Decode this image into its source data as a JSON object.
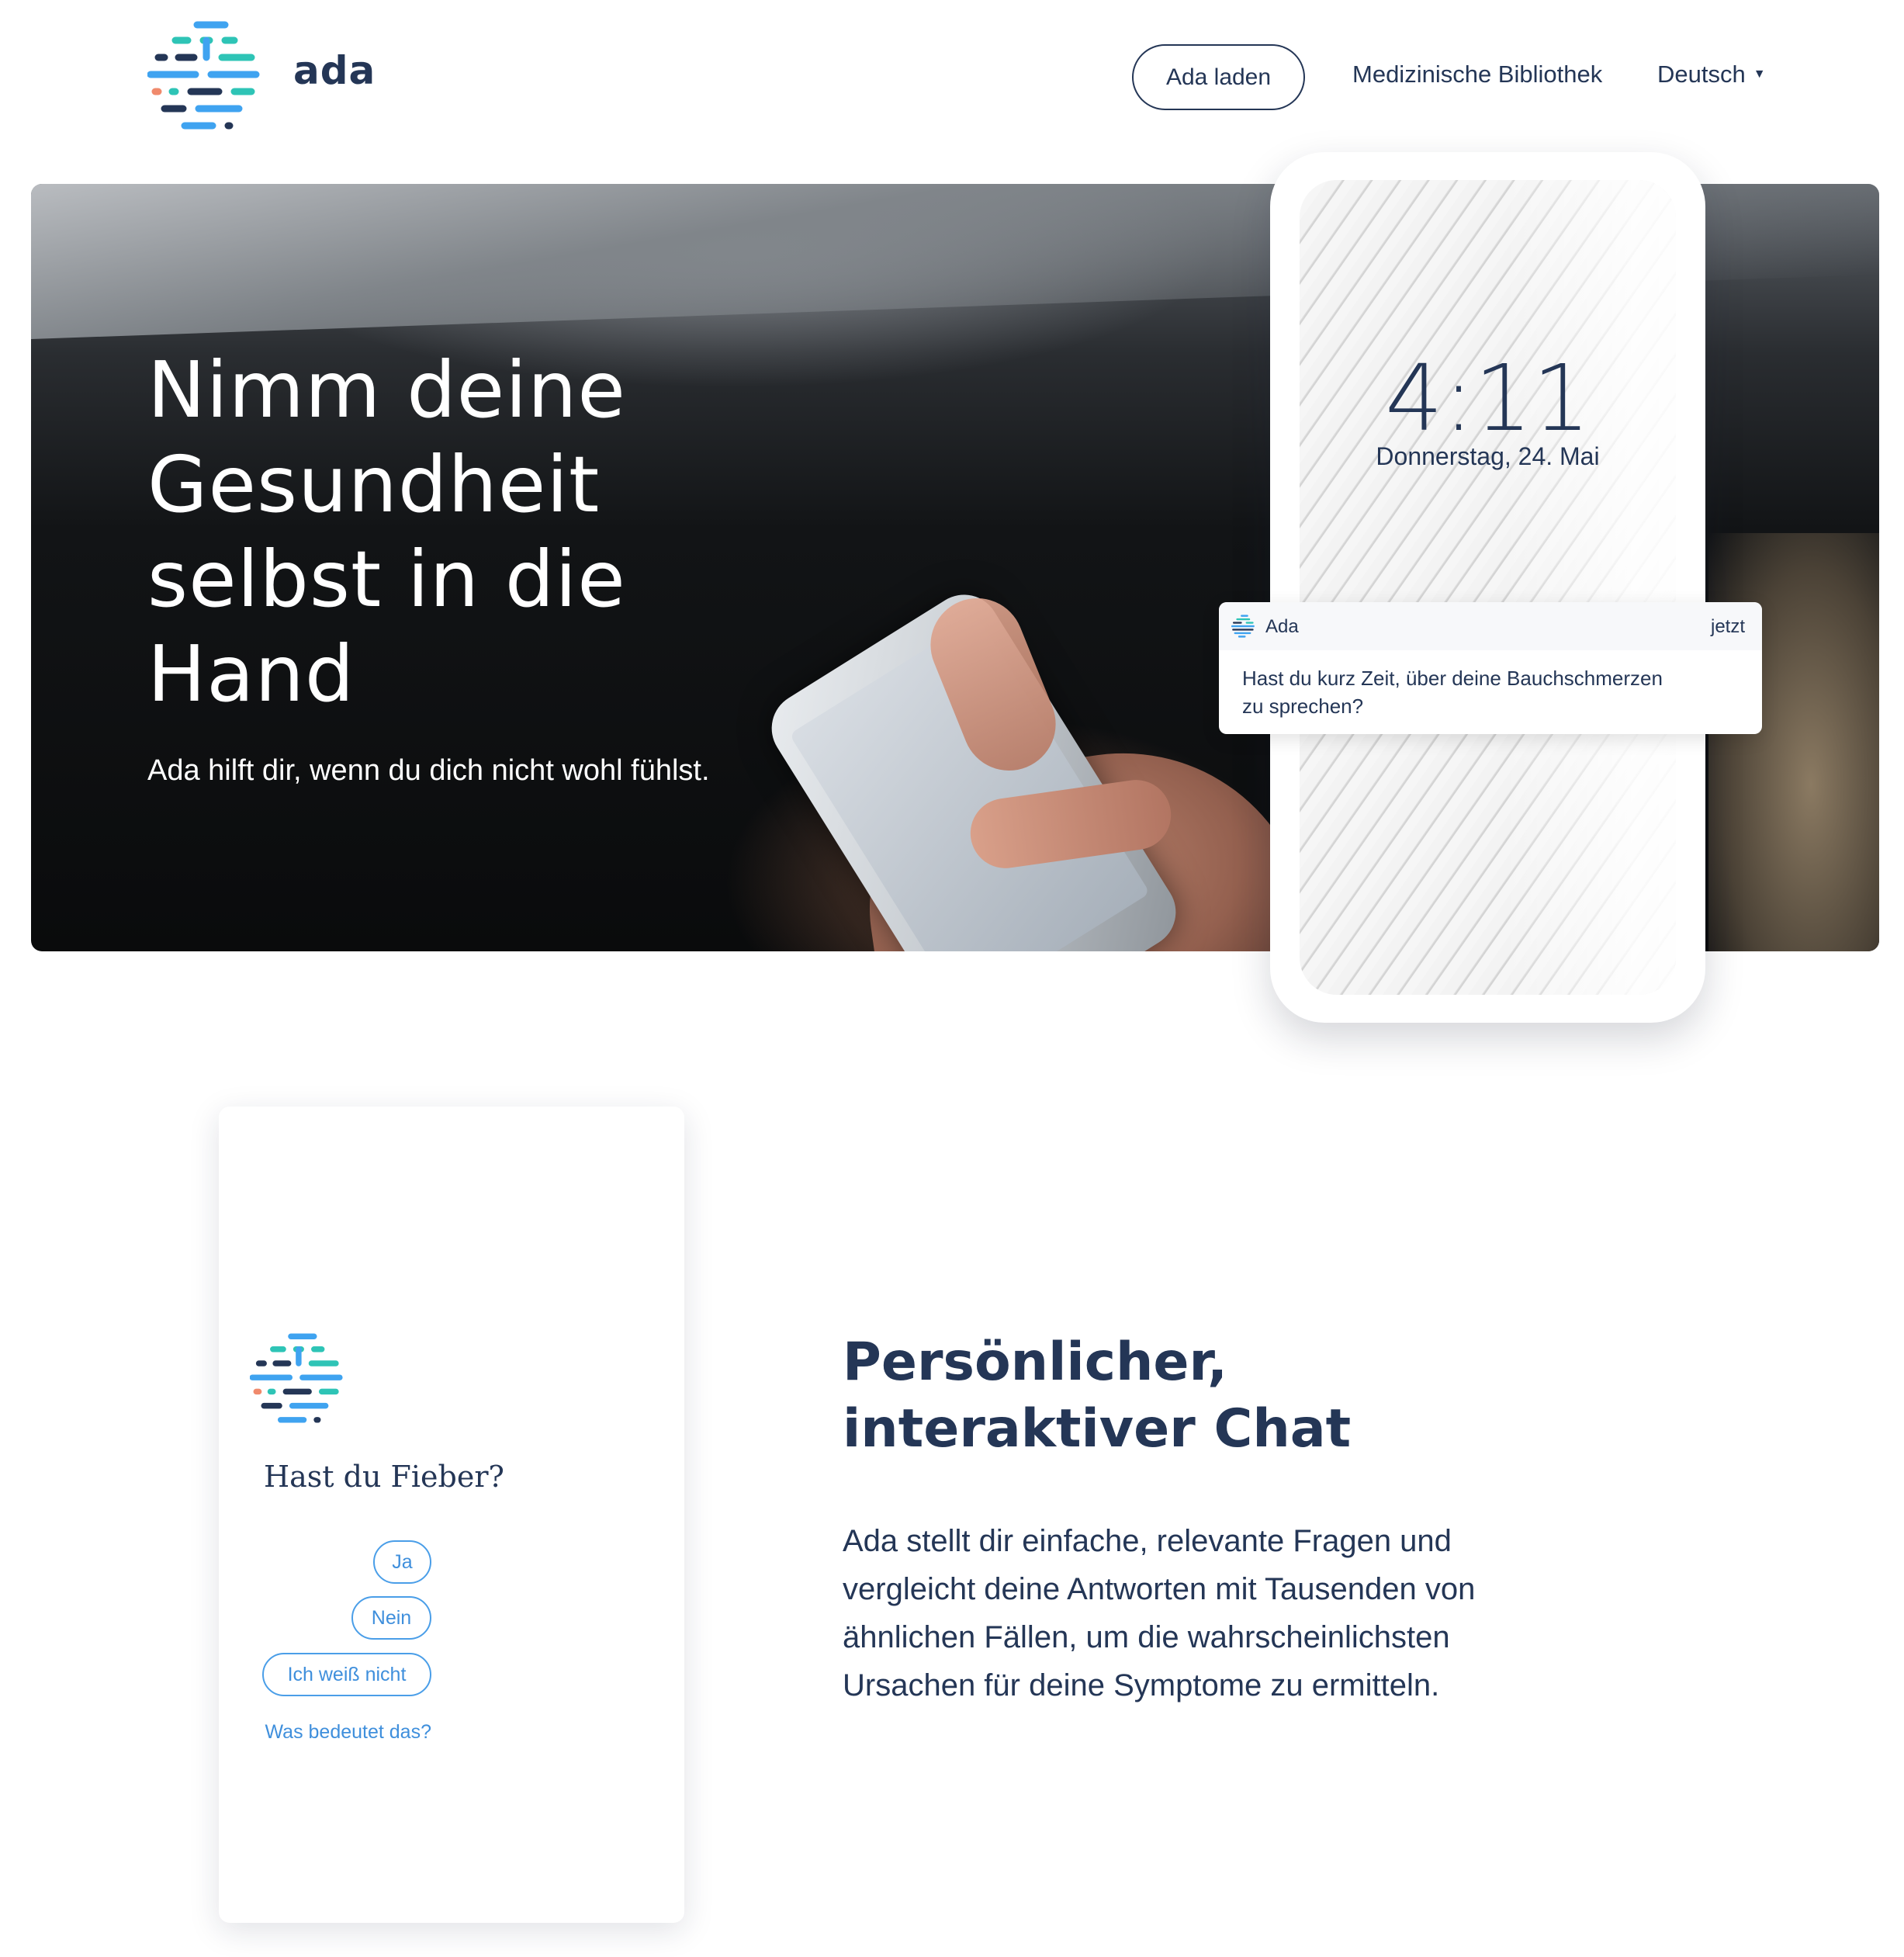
{
  "header": {
    "logo_text": "ada",
    "download_button": "Ada laden",
    "nav_library": "Medizinische Bibliothek",
    "nav_language": "Deutsch",
    "language_caret": "▼"
  },
  "hero": {
    "title": "Nimm deine Gesundheit selbst in die Hand",
    "subtitle": "Ada hilft dir, wenn du dich nicht wohl fühlst."
  },
  "lock_screen": {
    "time": "4:11",
    "date": "Donnerstag, 24. Mai",
    "notification": {
      "app": "Ada",
      "time": "jetzt",
      "message": "Hast du kurz Zeit, über deine Bauchschmerzen zu sprechen?"
    }
  },
  "chat": {
    "question": "Hast du Fieber?",
    "options": [
      "Ja",
      "Nein",
      "Ich weiß nicht"
    ],
    "help_link": "Was bedeutet das?"
  },
  "feature": {
    "title": "Persönlicher, interaktiver Chat",
    "body": "Ada stellt dir einfache, relevante Fragen und vergleicht deine Antworten mit Tausenden von ähnlichen Fällen, um die wahrscheinlichsten Ursachen für deine Symptome zu ermitteln."
  },
  "colors": {
    "brand_navy": "#243656",
    "link_blue": "#3f8fdc",
    "logo_teal": "#2ec4b6",
    "logo_blue": "#3fa3f0",
    "logo_coral": "#f08a6c"
  }
}
